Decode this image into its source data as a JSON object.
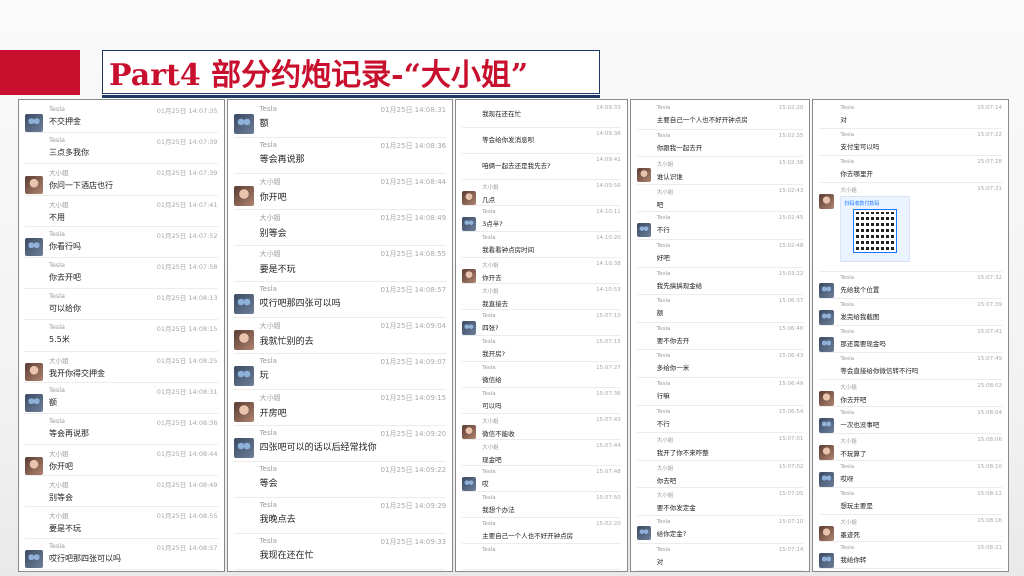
{
  "title": "Part4  部分约炮记录-“大小姐”",
  "colors": {
    "accent_red": "#c8102e",
    "navy": "#1f3864"
  },
  "panels": [
    {
      "messages": [
        {
          "sender": "Tesla",
          "avatar": "tesla",
          "time": "01月25日 14:07:35",
          "text": "不交押金"
        },
        {
          "sender": "Tesla",
          "avatar": "none",
          "time": "01月25日 14:07:39",
          "text": "三点多我你"
        },
        {
          "sender": "大小姐",
          "avatar": "girl",
          "time": "01月25日 14:07:39",
          "text": "你问一下酒店也行"
        },
        {
          "sender": "大小姐",
          "avatar": "none",
          "time": "01月25日 14:07:41",
          "text": "不用"
        },
        {
          "sender": "Tesla",
          "avatar": "tesla",
          "time": "01月25日 14:07:52",
          "text": "你看行吗"
        },
        {
          "sender": "Tesla",
          "avatar": "none",
          "time": "01月25日 14:07:58",
          "text": "你去开吧"
        },
        {
          "sender": "Tesla",
          "avatar": "none",
          "time": "01月25日 14:08:13",
          "text": "可以给你"
        },
        {
          "sender": "Tesla",
          "avatar": "none",
          "time": "01月25日 14:08:15",
          "text": "5.5米"
        },
        {
          "sender": "大小姐",
          "avatar": "girl",
          "time": "01月25日 14:08:25",
          "text": "我开你得交押金"
        },
        {
          "sender": "Tesla",
          "avatar": "tesla",
          "time": "01月25日 14:08:31",
          "text": "额"
        },
        {
          "sender": "Tesla",
          "avatar": "none",
          "time": "01月25日 14:08:36",
          "text": "等会再说那"
        },
        {
          "sender": "大小姐",
          "avatar": "girl",
          "time": "01月25日 14:08:44",
          "text": "你开吧"
        },
        {
          "sender": "大小姐",
          "avatar": "none",
          "time": "01月25日 14:08:49",
          "text": "别等会"
        },
        {
          "sender": "大小姐",
          "avatar": "none",
          "time": "01月25日 14:08:55",
          "text": "要是不玩"
        },
        {
          "sender": "Tesla",
          "avatar": "tesla",
          "time": "01月25日 14:08:57",
          "text": "哎行吧那四张可以吗"
        }
      ]
    },
    {
      "messages": [
        {
          "sender": "Tesla",
          "avatar": "tesla",
          "time": "01月25日 14:08:31",
          "text": "额"
        },
        {
          "sender": "Tesla",
          "avatar": "none",
          "time": "01月25日 14:08:36",
          "text": "等会再说那"
        },
        {
          "sender": "大小姐",
          "avatar": "girl",
          "time": "01月25日 14:08:44",
          "text": "你开吧"
        },
        {
          "sender": "大小姐",
          "avatar": "none",
          "time": "01月25日 14:08:49",
          "text": "别等会"
        },
        {
          "sender": "大小姐",
          "avatar": "none",
          "time": "01月25日 14:08:55",
          "text": "要是不玩"
        },
        {
          "sender": "Tesla",
          "avatar": "tesla",
          "time": "01月25日 14:08:57",
          "text": "哎行吧那四张可以吗"
        },
        {
          "sender": "大小姐",
          "avatar": "girl",
          "time": "01月25日 14:09:04",
          "text": "我就忙别的去"
        },
        {
          "sender": "Tesla",
          "avatar": "tesla",
          "time": "01月25日 14:09:07",
          "text": "玩"
        },
        {
          "sender": "大小姐",
          "avatar": "girl",
          "time": "01月25日 14:09:15",
          "text": "开房吧"
        },
        {
          "sender": "Tesla",
          "avatar": "tesla",
          "time": "01月25日 14:09:20",
          "text": "四张吧可以的话以后经常找你"
        },
        {
          "sender": "Tesla",
          "avatar": "none",
          "time": "01月25日 14:09:22",
          "text": "等会"
        },
        {
          "sender": "Tesla",
          "avatar": "none",
          "time": "01月25日 14:09:29",
          "text": "我晚点去"
        },
        {
          "sender": "Tesla",
          "avatar": "none",
          "time": "01月25日 14:09:33",
          "text": "我现在还在忙"
        }
      ]
    },
    {
      "messages": [
        {
          "sender": "",
          "avatar": "none",
          "time": "14:09:33",
          "text": "我现在还在忙"
        },
        {
          "sender": "",
          "avatar": "none",
          "time": "14:09:36",
          "text": "等会给你发消息呗"
        },
        {
          "sender": "",
          "avatar": "none",
          "time": "14:09:41",
          "text": "咱俩一起去还是我先去?"
        },
        {
          "sender": "大小姐",
          "avatar": "girl",
          "time": "14:09:56",
          "text": "几点"
        },
        {
          "sender": "Tesla",
          "avatar": "tesla",
          "time": "14:10:11",
          "text": "3点半?"
        },
        {
          "sender": "Tesla",
          "avatar": "none",
          "time": "14:10:20",
          "text": "我看看钟点房时间"
        },
        {
          "sender": "大小姐",
          "avatar": "girl",
          "time": "14:10:38",
          "text": "你开去"
        },
        {
          "sender": "大小姐",
          "avatar": "none",
          "time": "14:10:53",
          "text": "我直接去"
        },
        {
          "sender": "Tesla",
          "avatar": "tesla",
          "time": "15:07:10",
          "text": "四张?"
        },
        {
          "sender": "Tesla",
          "avatar": "none",
          "time": "15:07:15",
          "text": "我开房?"
        },
        {
          "sender": "Tesla",
          "avatar": "none",
          "time": "15:07:27",
          "text": "微信给"
        },
        {
          "sender": "Tesla",
          "avatar": "none",
          "time": "15:07:36",
          "text": "可以吗"
        },
        {
          "sender": "大小姐",
          "avatar": "girl",
          "time": "15:07:43",
          "text": "微信不能收"
        },
        {
          "sender": "大小姐",
          "avatar": "none",
          "time": "15:07:44",
          "text": "现金吧"
        },
        {
          "sender": "Tesla",
          "avatar": "tesla",
          "time": "15:07:48",
          "text": "哎"
        },
        {
          "sender": "Tesla",
          "avatar": "none",
          "time": "15:07:50",
          "text": "我想个办法"
        },
        {
          "sender": "Tesla",
          "avatar": "none",
          "time": "15:02:20",
          "text": "主要自己一个人也不好开钟点房"
        },
        {
          "sender": "Tesla",
          "avatar": "none",
          "time": "",
          "text": ""
        }
      ]
    },
    {
      "messages": [
        {
          "sender": "Tesla",
          "avatar": "none",
          "time": "15:02:20",
          "text": "主要自己一个人也不好开钟点房"
        },
        {
          "sender": "Tesla",
          "avatar": "none",
          "time": "15:02:35",
          "text": "你跟我一起去开"
        },
        {
          "sender": "大小姐",
          "avatar": "girl",
          "time": "15:02:38",
          "text": "谁认识谁"
        },
        {
          "sender": "大小姐",
          "avatar": "none",
          "time": "15:02:43",
          "text": "吧"
        },
        {
          "sender": "Tesla",
          "avatar": "tesla",
          "time": "15:02:45",
          "text": "不行"
        },
        {
          "sender": "Tesla",
          "avatar": "none",
          "time": "15:02:48",
          "text": "好吧"
        },
        {
          "sender": "Tesla",
          "avatar": "none",
          "time": "15:03:22",
          "text": "我先搞搞现金给"
        },
        {
          "sender": "Tesla",
          "avatar": "none",
          "time": "15:06:37",
          "text": "额"
        },
        {
          "sender": "Tesla",
          "avatar": "none",
          "time": "15:06:40",
          "text": "要不你去开"
        },
        {
          "sender": "Tesla",
          "avatar": "none",
          "time": "15:06:43",
          "text": "多给你一米"
        },
        {
          "sender": "Tesla",
          "avatar": "none",
          "time": "15:06:49",
          "text": "行嘛"
        },
        {
          "sender": "Tesla",
          "avatar": "none",
          "time": "15:06:54",
          "text": "不行"
        },
        {
          "sender": "大小姐",
          "avatar": "none",
          "time": "15:07:01",
          "text": "我开了你不来咋整"
        },
        {
          "sender": "大小姐",
          "avatar": "none",
          "time": "15:07:02",
          "text": "你去吧"
        },
        {
          "sender": "大小姐",
          "avatar": "none",
          "time": "15:07:05",
          "text": "要不你发定金"
        },
        {
          "sender": "Tesla",
          "avatar": "tesla",
          "time": "15:07:10",
          "text": "给你定金?"
        },
        {
          "sender": "Tesla",
          "avatar": "none",
          "time": "15:07:14",
          "text": "对"
        }
      ]
    },
    {
      "messages": [
        {
          "sender": "Tesla",
          "avatar": "none",
          "time": "15:07:14",
          "text": "对"
        },
        {
          "sender": "Tesla",
          "avatar": "none",
          "time": "15:07:22",
          "text": "支付宝可以吗"
        },
        {
          "sender": "Tesla",
          "avatar": "none",
          "time": "15:07:28",
          "text": "你去哪里开"
        },
        {
          "sender": "大小姐",
          "avatar": "girl",
          "time": "15:07:31",
          "text": "",
          "qr": "扫码收款付款码"
        },
        {
          "sender": "Tesla",
          "avatar": "tesla",
          "time": "15:07:32",
          "text": "先给我个位置"
        },
        {
          "sender": "Tesla",
          "avatar": "tesla",
          "time": "15:07:39",
          "text": "发完给我截图"
        },
        {
          "sender": "Tesla",
          "avatar": "tesla",
          "time": "15:07:41",
          "text": "那还需要现金吗"
        },
        {
          "sender": "Tesla",
          "avatar": "none",
          "time": "15:07:49",
          "text": "等会直接给你微信转不行吗"
        },
        {
          "sender": "大小姐",
          "avatar": "girl",
          "time": "15:08:02",
          "text": "你去开吧"
        },
        {
          "sender": "Tesla",
          "avatar": "tesla",
          "time": "15:08:04",
          "text": "一次也没事吧"
        },
        {
          "sender": "大小姐",
          "avatar": "girl",
          "time": "15:08:06",
          "text": "不玩算了"
        },
        {
          "sender": "Tesla",
          "avatar": "tesla",
          "time": "15:08:10",
          "text": "哎呀"
        },
        {
          "sender": "Tesla",
          "avatar": "none",
          "time": "15:08:12",
          "text": "想玩主要是"
        },
        {
          "sender": "大小姐",
          "avatar": "girl",
          "time": "15:08:16",
          "text": "墨迹死"
        },
        {
          "sender": "Tesla",
          "avatar": "tesla",
          "time": "15:08:21",
          "text": "我给你转"
        }
      ]
    }
  ]
}
